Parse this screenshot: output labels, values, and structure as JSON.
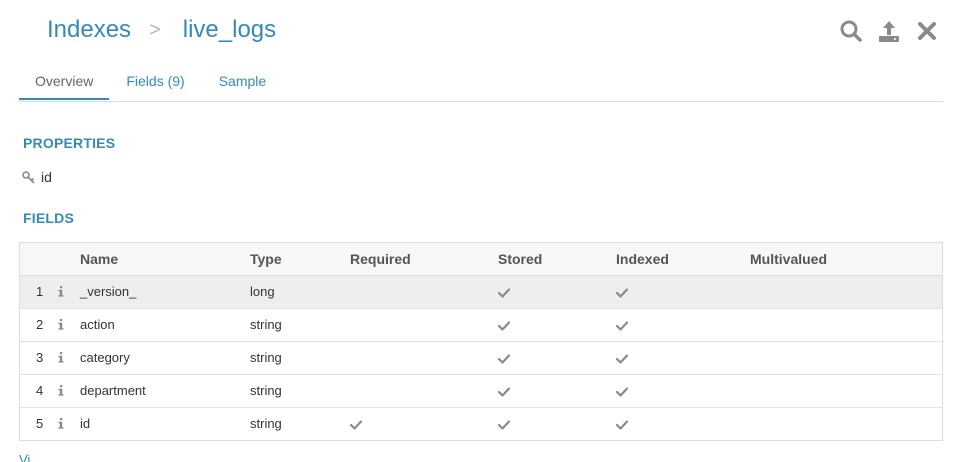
{
  "breadcrumb": {
    "root": "Indexes",
    "separator": ">",
    "current": "live_logs"
  },
  "actions": {
    "search_icon": "search-icon",
    "upload_icon": "upload-icon",
    "close_icon": "close-icon"
  },
  "tabs": [
    {
      "label": "Overview",
      "active": true
    },
    {
      "label": "Fields (9)",
      "active": false
    },
    {
      "label": "Sample",
      "active": false
    }
  ],
  "properties": {
    "title": "PROPERTIES",
    "items": [
      {
        "icon": "key-icon",
        "label": "id"
      }
    ]
  },
  "fields": {
    "title": "FIELDS",
    "columns": {
      "name": "Name",
      "type": "Type",
      "required": "Required",
      "stored": "Stored",
      "indexed": "Indexed",
      "multivalued": "Multivalued"
    },
    "rows": [
      {
        "num": "1",
        "name": "_version_",
        "type": "long",
        "required": false,
        "stored": true,
        "indexed": true,
        "multivalued": false,
        "selected": true
      },
      {
        "num": "2",
        "name": "action",
        "type": "string",
        "required": false,
        "stored": true,
        "indexed": true,
        "multivalued": false
      },
      {
        "num": "3",
        "name": "category",
        "type": "string",
        "required": false,
        "stored": true,
        "indexed": true,
        "multivalued": false
      },
      {
        "num": "4",
        "name": "department",
        "type": "string",
        "required": false,
        "stored": true,
        "indexed": true,
        "multivalued": false
      },
      {
        "num": "5",
        "name": "id",
        "type": "string",
        "required": true,
        "stored": true,
        "indexed": true,
        "multivalued": false
      }
    ]
  },
  "footer": {
    "link_text": "Vi"
  },
  "colors": {
    "accent": "#338bb8",
    "icon_gray": "#8a8a8a",
    "selected_row": "#eeeeee"
  }
}
